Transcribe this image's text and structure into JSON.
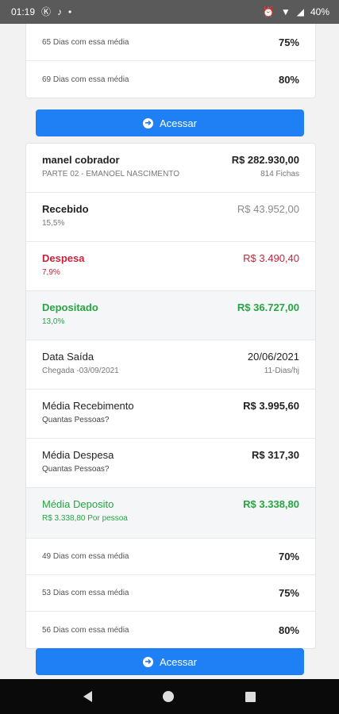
{
  "status_bar": {
    "time": "01:19",
    "battery": "40%"
  },
  "card_top": {
    "rows": [
      {
        "label": "65 Dias com essa média",
        "value": "75%"
      },
      {
        "label": "69 Dias com essa média",
        "value": "80%"
      }
    ]
  },
  "button_1": {
    "label": "Acessar"
  },
  "card_main": {
    "header": {
      "name": "manel cobrador",
      "subtitle": "PARTE 02 - EMANOEL NASCIMENTO",
      "total": "R$ 282.930,00",
      "fichas": "814 Fichas"
    },
    "recebido": {
      "label": "Recebido",
      "sub": "15,5%",
      "value": "R$ 43.952,00"
    },
    "despesa": {
      "label": "Despesa",
      "sub": "7,9%",
      "value": "R$ 3.490,40"
    },
    "depositado": {
      "label": "Depositado",
      "sub": "13,0%",
      "value": "R$ 36.727,00"
    },
    "data_saida": {
      "label": "Data Saída",
      "sub": "Chegada -03/09/2021",
      "value": "20/06/2021",
      "value_sub": "11-Dias/hj"
    },
    "media_recebimento": {
      "label": "Média Recebimento",
      "sub": "Quantas Pessoas?",
      "value": "R$ 3.995,60"
    },
    "media_despesa": {
      "label": "Média Despesa",
      "sub": "Quantas Pessoas?",
      "value": "R$ 317,30"
    },
    "media_deposito": {
      "label": "Média Deposito",
      "sub": "R$ 3.338,80 Por pessoa",
      "value": "R$ 3.338,80"
    },
    "dias_rows": [
      {
        "label": "49 Dias com essa média",
        "value": "70%"
      },
      {
        "label": "53 Dias com essa média",
        "value": "75%"
      },
      {
        "label": "56 Dias com essa média",
        "value": "80%"
      }
    ]
  },
  "button_2": {
    "label": "Acessar"
  },
  "colors": {
    "accent": "#1f80f5",
    "red": "#c8233c",
    "green": "#27a543"
  }
}
